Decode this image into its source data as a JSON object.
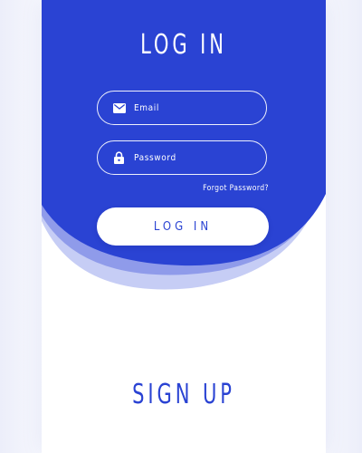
{
  "login": {
    "title": "LOG IN",
    "email_placeholder": "Email",
    "password_placeholder": "Password",
    "forgot_link": "Forgot Password?",
    "button_label": "LOG IN"
  },
  "signup": {
    "title": "SIGN UP"
  },
  "colors": {
    "primary": "#2a43d3",
    "background": "#ffffff"
  },
  "icons": {
    "email": "mail-icon",
    "password": "lock-icon"
  }
}
